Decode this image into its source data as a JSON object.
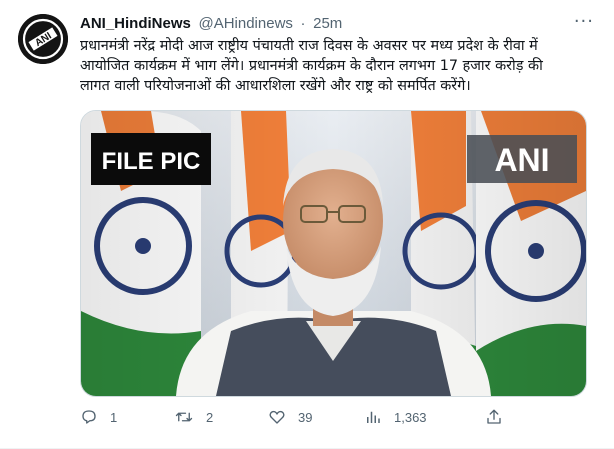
{
  "tweet": {
    "author_name": "ANI_HindiNews",
    "handle": "@AHindinews",
    "separator": "·",
    "time": "25m",
    "avatar_text": "ANI",
    "more": "···",
    "text_lines": [
      "प्रधानमंत्री नरेंद्र मोदी आज राष्ट्रीय पंचायती राज दिवस के अवसर पर मध्य प्रदेश के रीवा में",
      "आयोजित कार्यक्रम में भाग लेंगे। प्रधानमंत्री कार्यक्रम के दौरान लगभग 17 हजार करोड़ की",
      "लागत वाली परियोजनाओं की आधारशिला रखेंगे और राष्ट्र को समर्पित करेंगे।"
    ]
  },
  "media": {
    "file_pic_label": "FILE PIC",
    "watermark": "ANI"
  },
  "actions": {
    "reply_count": "1",
    "retweet_count": "2",
    "like_count": "39",
    "views_count": "1,363"
  },
  "colors": {
    "saffron": "#f2803a",
    "green": "#2e8a3c",
    "chakra": "#2b3f78",
    "vest": "#454d5c",
    "icon_gray": "#536471"
  }
}
